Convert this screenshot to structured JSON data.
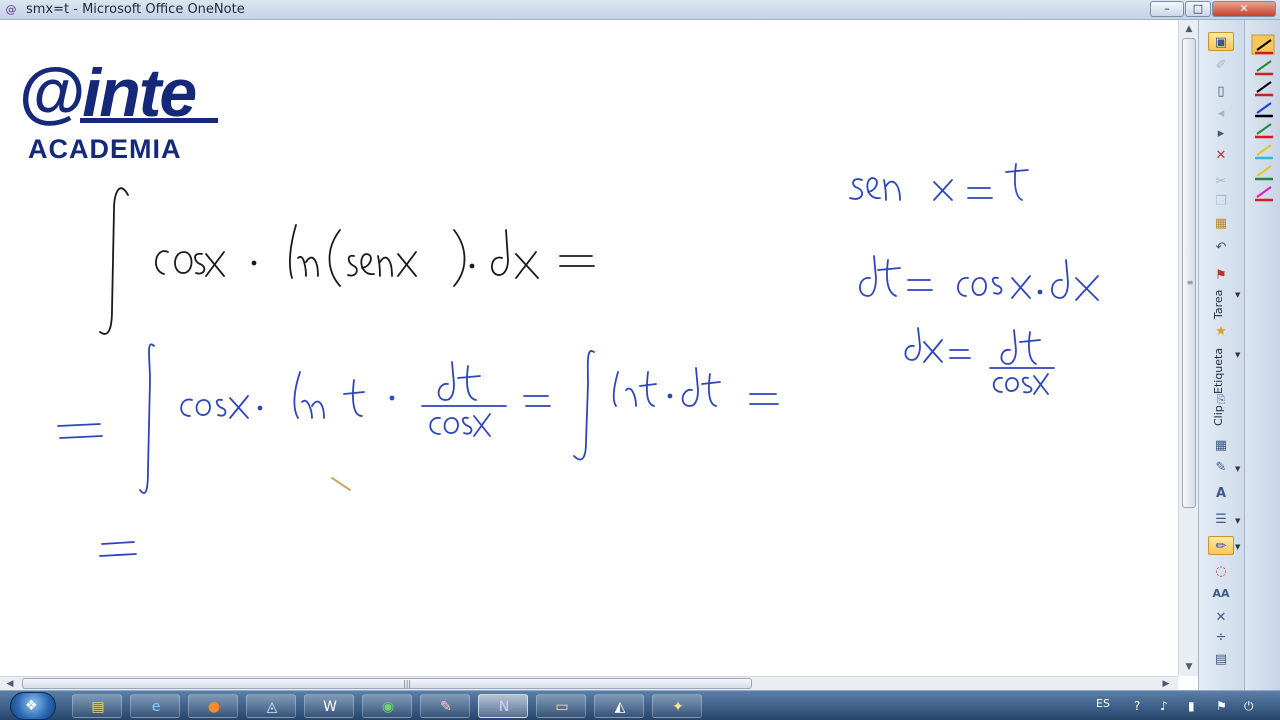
{
  "window": {
    "title": "smx=t - Microsoft Office OneNote",
    "app_icon": "onenote-icon",
    "buttons": {
      "minimize": "–",
      "maximize": "□",
      "close": "✕"
    }
  },
  "logo": {
    "brand": "@inte",
    "subtitle": "ACADEMIA",
    "color": "#16287a"
  },
  "ink": {
    "color_blue": "#2f46b8",
    "color_black": "#1a1a1a"
  },
  "toolbar": {
    "tarea_label": "Tarea",
    "etiqueta_label": "Etiqueta",
    "clip_label": "Clip",
    "text_tool": "A",
    "text_format_tool": "AA"
  },
  "pens": {
    "colors": [
      "#000000",
      "#d11f1f",
      "#1f8a2e",
      "#d11f1f",
      "#000000",
      "#d11f1f",
      "#1f3fd1",
      "#000000",
      "#1f8a2e",
      "#d11f1f",
      "#e7c42a",
      "#2fb8e0",
      "#e7c42a",
      "#1f8a2e",
      "#e01fb8",
      "#d11f1f"
    ],
    "active_index": 1
  },
  "taskbar": {
    "language": "ES",
    "apps": [
      {
        "name": "explorer",
        "glyph": "▤",
        "color": "#f4d36a"
      },
      {
        "name": "internet-explorer",
        "glyph": "e",
        "color": "#7fd0ff"
      },
      {
        "name": "firefox",
        "glyph": "●",
        "color": "#ff8a2a"
      },
      {
        "name": "network",
        "glyph": "◬",
        "color": "#d7e9ff"
      },
      {
        "name": "word",
        "glyph": "W",
        "color": "#ffffff"
      },
      {
        "name": "chrome",
        "glyph": "◉",
        "color": "#6dd36a"
      },
      {
        "name": "paint",
        "glyph": "✎",
        "color": "#ffc7c7"
      },
      {
        "name": "onenote",
        "glyph": "N",
        "color": "#e0c6ff"
      },
      {
        "name": "notes",
        "glyph": "▭",
        "color": "#ffe58a"
      },
      {
        "name": "drive",
        "glyph": "◭",
        "color": "#ffffff"
      },
      {
        "name": "tools",
        "glyph": "✦",
        "color": "#ffe58a"
      }
    ]
  }
}
